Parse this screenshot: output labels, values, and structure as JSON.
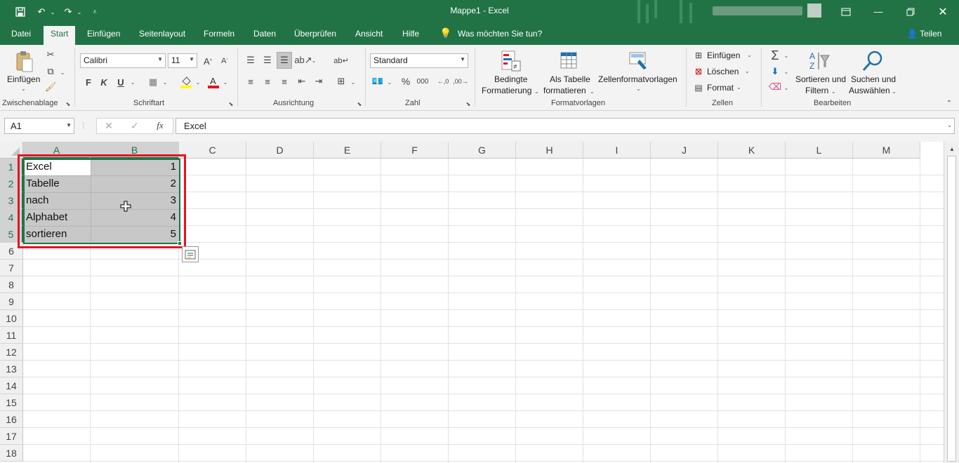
{
  "window": {
    "title": "Mappe1  -  Excel",
    "share_label": "Teilen"
  },
  "tabs": [
    "Datei",
    "Start",
    "Einfügen",
    "Seitenlayout",
    "Formeln",
    "Daten",
    "Überprüfen",
    "Ansicht",
    "Hilfe"
  ],
  "tellme": "Was möchten Sie tun?",
  "ribbon": {
    "clipboard": {
      "paste": "Einfügen",
      "group": "Zwischenablage"
    },
    "font": {
      "name": "Calibri",
      "size": "11",
      "bold": "F",
      "italic": "K",
      "underline": "U",
      "group": "Schriftart"
    },
    "alignment": {
      "group": "Ausrichtung"
    },
    "number": {
      "format": "Standard",
      "group": "Zahl"
    },
    "styles": {
      "conditional_1": "Bedingte",
      "conditional_2": "Formatierung",
      "table_1": "Als Tabelle",
      "table_2": "formatieren",
      "cellstyles": "Zellenformatvorlagen",
      "group": "Formatvorlagen"
    },
    "cells": {
      "insert": "Einfügen",
      "delete": "Löschen",
      "format": "Format",
      "group": "Zellen"
    },
    "editing": {
      "sort_1": "Sortieren und",
      "sort_2": "Filtern",
      "find_1": "Suchen und",
      "find_2": "Auswählen",
      "group": "Bearbeiten"
    }
  },
  "formula_bar": {
    "name_box": "A1",
    "content": "Excel"
  },
  "columns": [
    "A",
    "B",
    "C",
    "D",
    "E",
    "F",
    "G",
    "H",
    "I",
    "J",
    "K",
    "L",
    "M"
  ],
  "rows": [
    "1",
    "2",
    "3",
    "4",
    "5",
    "6",
    "7",
    "8",
    "9",
    "10",
    "11",
    "12",
    "13",
    "14",
    "15",
    "16",
    "17",
    "18"
  ],
  "cells": {
    "A": [
      "Excel",
      "Tabelle",
      "nach",
      "Alphabet",
      "sortieren"
    ],
    "B": [
      "1",
      "2",
      "3",
      "4",
      "5"
    ]
  },
  "colors": {
    "accent": "#217346",
    "highlight": "#e81123",
    "selection": "#c8c8c8"
  }
}
